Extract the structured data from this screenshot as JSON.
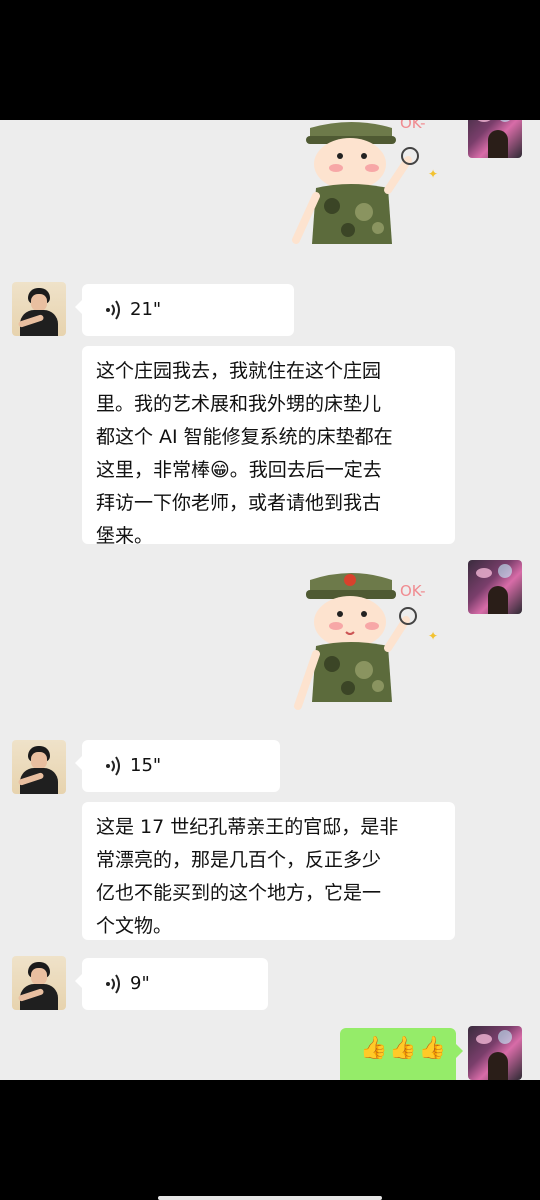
{
  "messages": {
    "sticker_text": "OK-",
    "voice1": {
      "duration": "21\""
    },
    "text1": "这个庄园我去，我就住在这个庄园\n里。我的艺术展和我外甥的床垫儿\n都这个 AI 智能修复系统的床垫都在\n这里，非常棒😁。我回去后一定去\n拜访一下你老师，或者请他到我古\n堡来。",
    "voice2": {
      "duration": "15\""
    },
    "text2": "这是 17 世纪孔蒂亲王的官邸，是非\n常漂亮的，那是几百个，反正多少\n亿也不能买到的这个地方，它是一\n个文物。",
    "voice3": {
      "duration": "9\""
    },
    "reply_emoji": "👍👍👍"
  },
  "icons": {
    "voice": "voice-wave-icon",
    "sticker": "soldier-ok-sticker",
    "avatar_other": "woman-avatar",
    "avatar_self": "self-avatar"
  },
  "colors": {
    "chat_bg": "#ededed",
    "bubble_received": "#ffffff",
    "bubble_sent": "#95ec69"
  }
}
